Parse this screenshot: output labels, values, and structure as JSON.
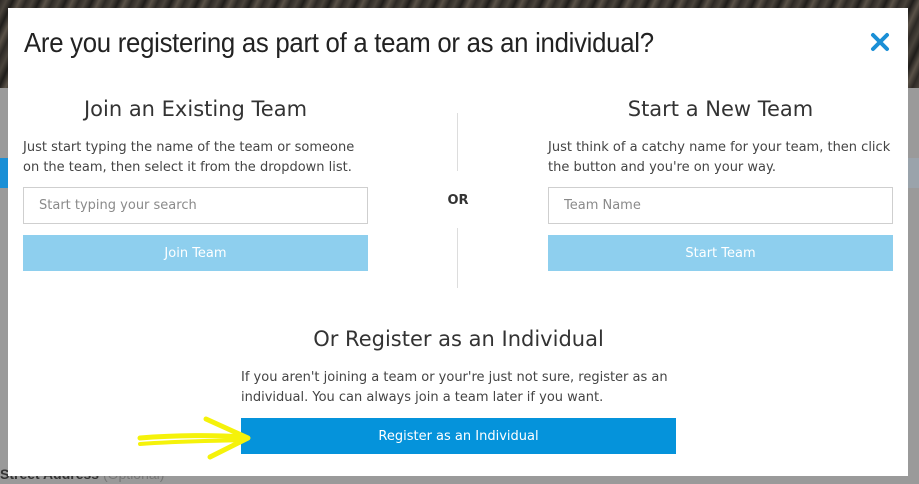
{
  "background": {
    "street_label": "Street Address",
    "street_optional": "(Optional)"
  },
  "modal": {
    "title": "Are you registering as part of a team or as an individual?",
    "close_icon": "close-icon",
    "join": {
      "heading": "Join an Existing Team",
      "description": "Just start typing the name of the team or someone on the team, then select it from the dropdown list.",
      "search_placeholder": "Start typing your search",
      "search_value": "",
      "button_label": "Join Team"
    },
    "or_label": "OR",
    "start": {
      "heading": "Start a New Team",
      "description": "Just think of a catchy name for your team, then click the button and you're on your way.",
      "name_placeholder": "Team Name",
      "name_value": "",
      "button_label": "Start Team"
    },
    "individual": {
      "heading": "Or Register as an Individual",
      "description": "If you aren't joining a team or your're just not sure, register as an individual. You can always join a team later if you want.",
      "button_label": "Register as an Individual"
    }
  },
  "colors": {
    "light_button": "#8ecfee",
    "primary_button": "#0593db",
    "close_icon": "#1a8fd6",
    "annotation_arrow": "#f5f20a"
  }
}
